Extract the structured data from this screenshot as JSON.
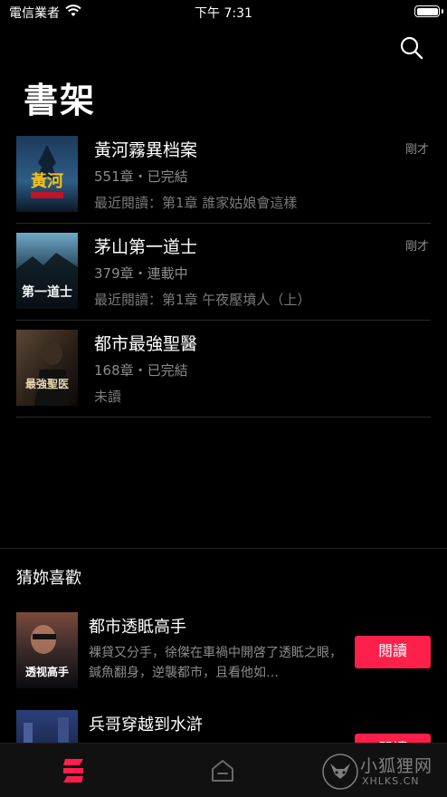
{
  "status_bar": {
    "carrier": "電信業者",
    "time": "下午 7:31"
  },
  "page": {
    "title": "書架"
  },
  "shelf": [
    {
      "title": "黃河霧異档案",
      "meta": "551章・已完結",
      "recent": "最近閱讀：第1章 誰家姑娘會這樣",
      "time": "剛才",
      "cover_text": "黃河"
    },
    {
      "title": "茅山第一道士",
      "meta": "379章・連載中",
      "recent": "最近閱讀：第1章 午夜壓墳人（上）",
      "time": "剛才",
      "cover_text": "第一道士"
    },
    {
      "title": "都市最強聖醫",
      "meta": "168章・已完結",
      "recent": "未讀",
      "time": "",
      "cover_text": "最強聖医"
    }
  ],
  "recommend": {
    "header": "猜妳喜歡",
    "items": [
      {
        "title": "都市透眡高手",
        "desc": "裸貸又分手，徐傑在車禍中開啓了透眡之眼，鍼魚翻身，逆襲都市，且看他如…",
        "button": "閱讀",
        "cover_text": "透视高手"
      },
      {
        "title": "兵哥穿越到水滸",
        "desc": "",
        "button": "閱讀",
        "cover_text": ""
      }
    ]
  },
  "tabs": [
    {
      "name": "shelf"
    },
    {
      "name": "home"
    }
  ],
  "watermark": {
    "text": "小狐狸网",
    "sub": "XHLKS.CN"
  },
  "colors": {
    "accent": "#ff1f4b",
    "background": "#000000",
    "muted": "#8c8c8c"
  }
}
